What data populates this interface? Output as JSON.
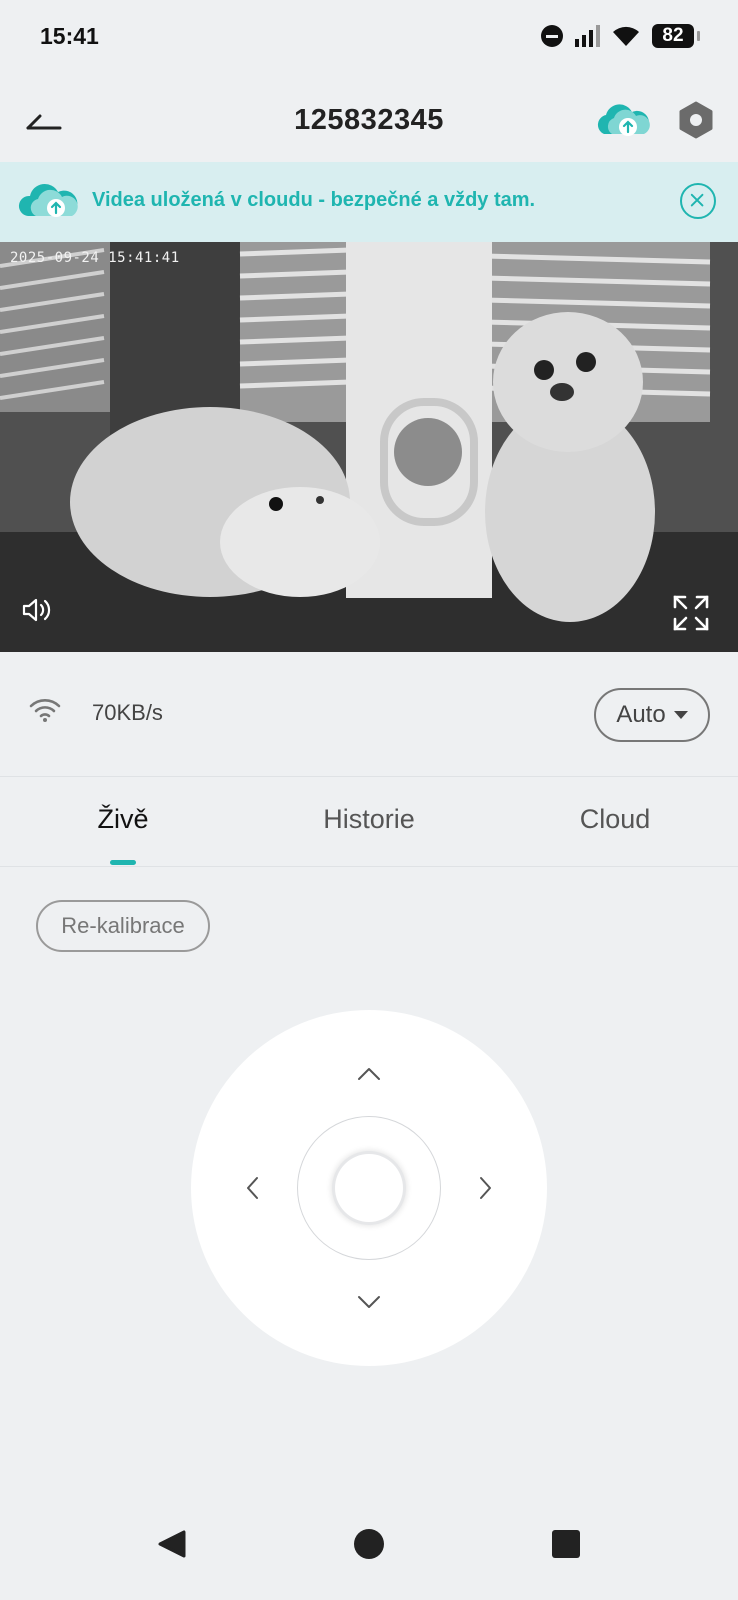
{
  "status_bar": {
    "time": "15:41",
    "battery": "82",
    "icons": [
      "do-not-disturb-icon",
      "signal-icon",
      "wifi-icon",
      "battery-icon"
    ]
  },
  "header": {
    "title": "125832345",
    "back_icon": "back-arrow-icon",
    "cloud_icon": "cloud-upload-icon",
    "settings_icon": "hexagon-settings-icon"
  },
  "banner": {
    "text": "Videa uložená v cloudu - bezpečné a vždy tam.",
    "icon": "cloud-upload-icon",
    "close_icon": "close-circle-icon"
  },
  "video": {
    "timestamp": "2025-09-24 15:41:41",
    "sound_icon": "speaker-icon",
    "fullscreen_icon": "fullscreen-icon"
  },
  "stream": {
    "speed": "70KB/s",
    "quality": "Auto"
  },
  "tabs": [
    {
      "label": "Živě",
      "active": true
    },
    {
      "label": "Historie",
      "active": false
    },
    {
      "label": "Cloud",
      "active": false
    }
  ],
  "controls": {
    "recalibrate_label": "Re-kalibrace"
  },
  "colors": {
    "accent": "#1fb5b0",
    "banner_bg": "#d8eef0",
    "page_bg": "#eef0f2"
  }
}
